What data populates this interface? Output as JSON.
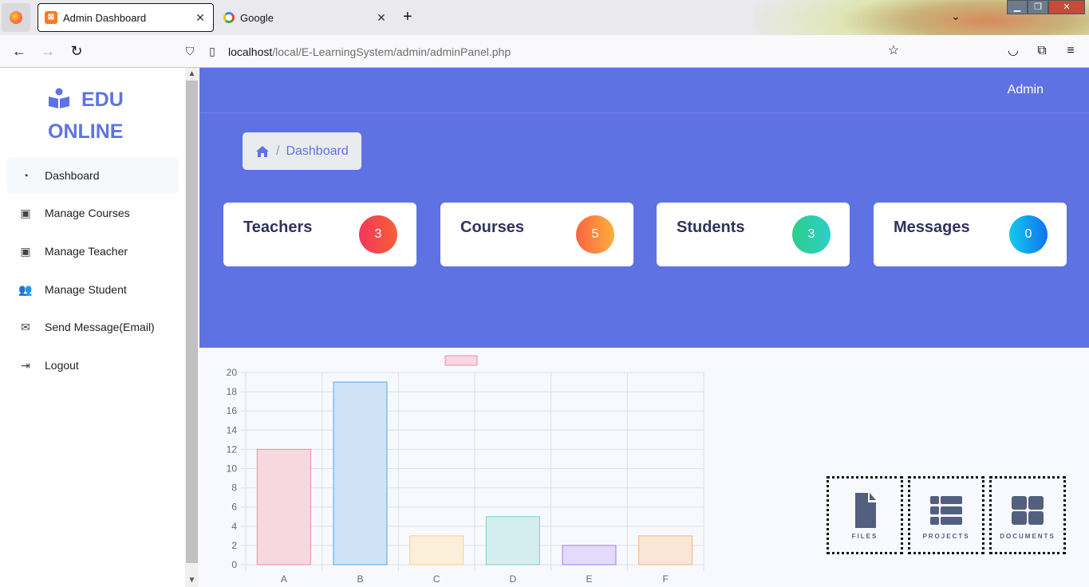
{
  "browser": {
    "tabs": [
      {
        "title": "Admin Dashboard",
        "active": true
      },
      {
        "title": "Google",
        "active": false
      }
    ],
    "url_host": "localhost",
    "url_path": "/local/E-LearningSystem/admin/adminPanel.php"
  },
  "sidebar": {
    "brand_line1": "EDU",
    "brand_line2": "ONLINE",
    "items": [
      {
        "label": "Dashboard",
        "icon": "gauge-icon"
      },
      {
        "label": "Manage Courses",
        "icon": "id-card-icon"
      },
      {
        "label": "Manage Teacher",
        "icon": "user-card-icon"
      },
      {
        "label": "Manage Student",
        "icon": "users-icon"
      },
      {
        "label": "Send Message(Email)",
        "icon": "mail-icon"
      },
      {
        "label": "Logout",
        "icon": "logout-icon"
      }
    ]
  },
  "header": {
    "user": "Admin",
    "breadcrumb": "Dashboard"
  },
  "stats": [
    {
      "title": "Teachers",
      "count": "3",
      "color": "#f5365c"
    },
    {
      "title": "Courses",
      "count": "5",
      "color": "#fb6340"
    },
    {
      "title": "Students",
      "count": "3",
      "color": "#2dce89"
    },
    {
      "title": "Messages",
      "count": "0",
      "color": "#11cdef"
    }
  ],
  "chart_data": {
    "type": "bar",
    "categories": [
      "A",
      "B",
      "C",
      "D",
      "E",
      "F"
    ],
    "values": [
      12,
      19,
      3,
      5,
      2,
      3
    ],
    "ylim": [
      0,
      20
    ],
    "yticks": [
      0,
      2,
      4,
      6,
      8,
      10,
      12,
      14,
      16,
      18,
      20
    ],
    "grid": true,
    "legend_position": "top",
    "colors": [
      "#f7d8e1",
      "#cfe3f7",
      "#fbefd9",
      "#d4eef0",
      "#e3dafd",
      "#fbe6d6"
    ],
    "borders": [
      "#f08aa6",
      "#56a7e0",
      "#f7cf86",
      "#7ccfcf",
      "#9f7bf3",
      "#f6b37f"
    ]
  },
  "tiles": [
    {
      "label": "FILES",
      "icon": "file-icon"
    },
    {
      "label": "PROJECTS",
      "icon": "list-icon"
    },
    {
      "label": "DOCUMENTS",
      "icon": "grid-icon"
    }
  ]
}
